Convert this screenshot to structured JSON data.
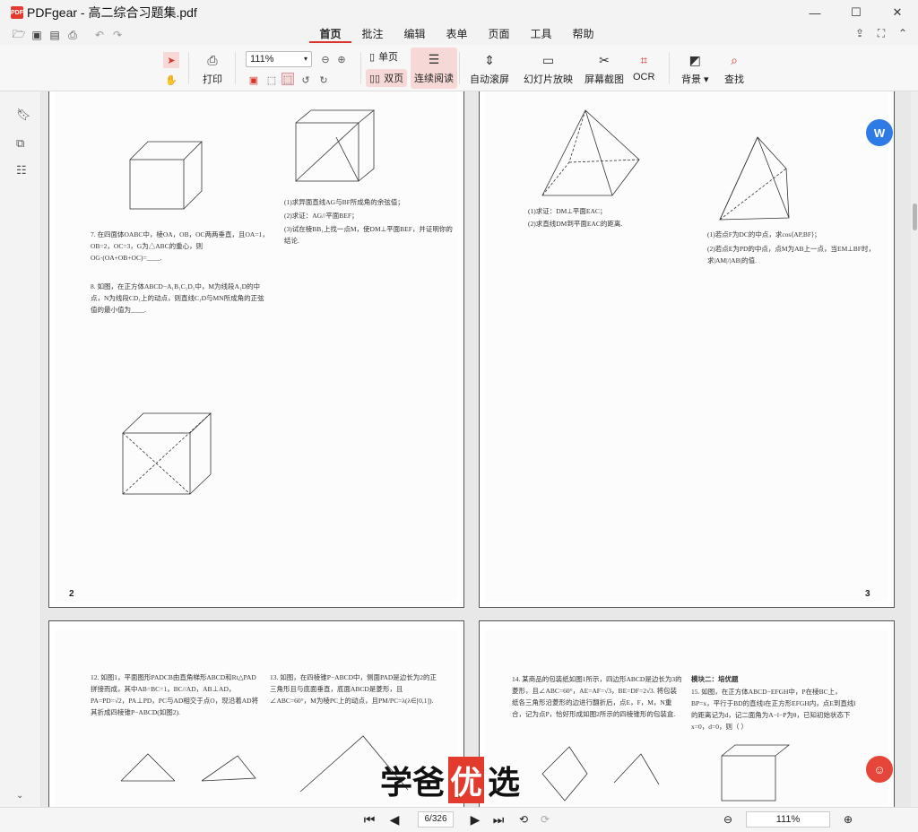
{
  "app": {
    "name": "PDFgear",
    "title": "PDFgear - 高二综合习题集.pdf",
    "logo_text": "PDF"
  },
  "window": {
    "minimize": "—",
    "maximize": "☐",
    "close": "✕"
  },
  "menu": {
    "tabs": [
      "首页",
      "批注",
      "编辑",
      "表单",
      "页面",
      "工具",
      "帮助"
    ],
    "active_tab": "首页"
  },
  "toolbar": {
    "print_label": "打印",
    "zoom_value": "111%",
    "single_page_label": "单页",
    "double_page_label": "双页",
    "continuous_label": "连续阅读",
    "auto_scroll_label": "自动滚屏",
    "slideshow_label": "幻灯片放映",
    "screenshot_label": "屏幕截图",
    "ocr_label": "OCR",
    "background_label": "背景",
    "search_label": "查找"
  },
  "pages": [
    {
      "number": "2"
    },
    {
      "number": "3"
    }
  ],
  "page_texts": {
    "p2_q7": "7. 在四面体OABC中，棱OA，OB，OC两两垂直，且OA=1，OB=2，OC=3，G为△ABC的重心，则OG·(OA+OB+OC)=____.",
    "p2_q8": "8. 如图，在正方体ABCD−A₁B₁C₁D₁中，M为线段A₁D的中点，N为线段CD₁上的动点，则直线C₁D与MN所成角的正弦值的最小值为____.",
    "p2_r1": "(1)求异面直线AG与BF所成角的余弦值；",
    "p2_r2": "(2)求证：AG//平面BEF；",
    "p2_r3": "(3)试在棱BB₁上找一点M，使DM⊥平面BEF，并证明你的结论.",
    "p3_l1": "(1)求证：DM⊥平面EAC；",
    "p3_l2": "(2)求直线DM到平面EAC的距离.",
    "p3_r1": "(1)若点F为DC的中点，求cos⟨AP,BF⟩；",
    "p3_r2": "(2)若点E为PD的中点，点M为AB上一点，当EM⊥BF时，求|AM|/|AB|的值.",
    "p4_q12": "12. 如图1，平面图形PADCB由直角梯形ABCD和Rt△PAD拼接而成，其中AB=BC=1，BC//AD，AB⊥AD，PA=PD=√2，PA⊥PD，PC与AD相交于点O，现沿着AD将其折成四棱锥P−ABCD(如图2).",
    "p4_q13": "13. 如图，在四棱锥P−ABCD中，侧面PAD是边长为2的正三角形且与底面垂直，底面ABCD是菱形，且∠ABC=60°，M为棱PC上的动点，且PM/PC=λ(λ∈[0,1]).",
    "p5_q14": "14. 某商品的包装纸如图1所示，四边形ABCD是边长为3的菱形，且∠ABC=60°，AE=AF=√3，BE=DF=2√3. 将包装纸各三角形沿菱形的边进行翻折后，点E，F，M，N重合，记为点P，恰好形成如图2所示的四棱锥形的包装盒.",
    "p5_module": "模块二：培优题",
    "p5_q15": "15. 如图，在正方体ABCD−EFGH中，P在棱BC上，BP=x，平行于BD的直线l在正方形EFGH内，点E到直线l的距离记为d，记二面角为A−l−P为θ，已知初始状态下x=0，d=0，则（    ）"
  },
  "navigation": {
    "current_page": "6",
    "total_pages": "/326",
    "page_display": "6/326",
    "zoom": "111%"
  },
  "watermark": {
    "part1": "学爸",
    "highlight": "优",
    "part2": "选"
  },
  "colors": {
    "accent": "#d9342b",
    "highlight_bg": "#f6d9d6",
    "float_blue": "#2f7be5",
    "float_red": "#e6463a"
  }
}
